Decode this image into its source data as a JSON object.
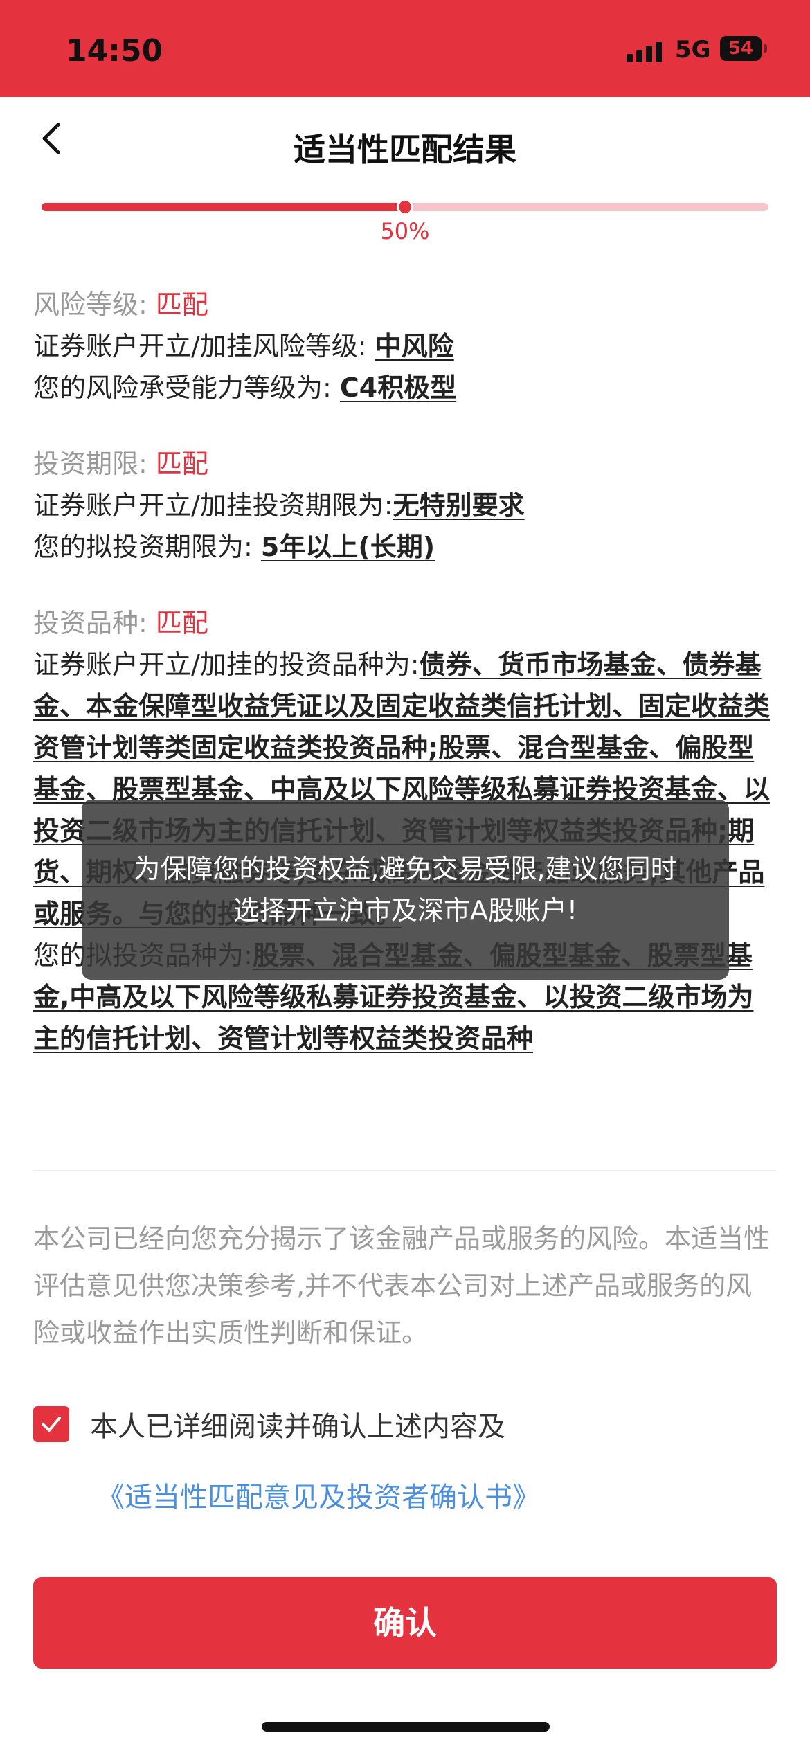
{
  "status_bar": {
    "time": "14:50",
    "network": "5G",
    "battery": "54"
  },
  "nav": {
    "title": "适当性匹配结果"
  },
  "progress": {
    "percent": 50,
    "label": "50%"
  },
  "risk": {
    "heading": "风险等级:",
    "status": "匹配",
    "product_label": "证券账户开立/加挂风险等级:",
    "product_value": "中风险",
    "user_label": "您的风险承受能力等级为:",
    "user_value": "C4积极型"
  },
  "term": {
    "heading": "投资期限:",
    "status": "匹配",
    "product_label": "证券账户开立/加挂投资期限为:",
    "product_value": "无特别要求",
    "user_label": "您的拟投资期限为:",
    "user_value": "5年以上(长期)"
  },
  "variety": {
    "heading": "投资品种:",
    "status": "匹配",
    "product_label": "证券账户开立/加挂的投资品种为:",
    "product_value": "债券、货币市场基金、债券基金、本金保障型收益凭证以及固定收益类信托计划、固定收益类资管计划等类固定收益类投资品种;股票、混合型基金、偏股型基金、股票型基金、中高及以下风险等级私募证券投资基金、以投资二级市场为主的信托计划、资管计划等权益类投资品种;期货、期权、融资融券等;复杂或高风险金融产品或服务;其他产品或服务。与您的投资品种一致。",
    "user_label": "您的拟投资品种为:",
    "user_value": "股票、混合型基金、偏股型基金、股票型基金,中高及以下风险等级私募证券投资基金、以投资二级市场为主的信托计划、资管计划等权益类投资品种"
  },
  "disclaimer": "本公司已经向您充分揭示了该金融产品或服务的风险。本适当性评估意见供您决策参考,并不代表本公司对上述产品或服务的风险或收益作出实质性判断和保证。",
  "agreement": {
    "checked": true,
    "text": "本人已详细阅读并确认上述内容及",
    "link": "《适当性匹配意见及投资者确认书》"
  },
  "confirm_button": "确认",
  "toast": "为保障您的投资权益,避免交易受限,建议您同时选择开立沪市及深市A股账户!"
}
